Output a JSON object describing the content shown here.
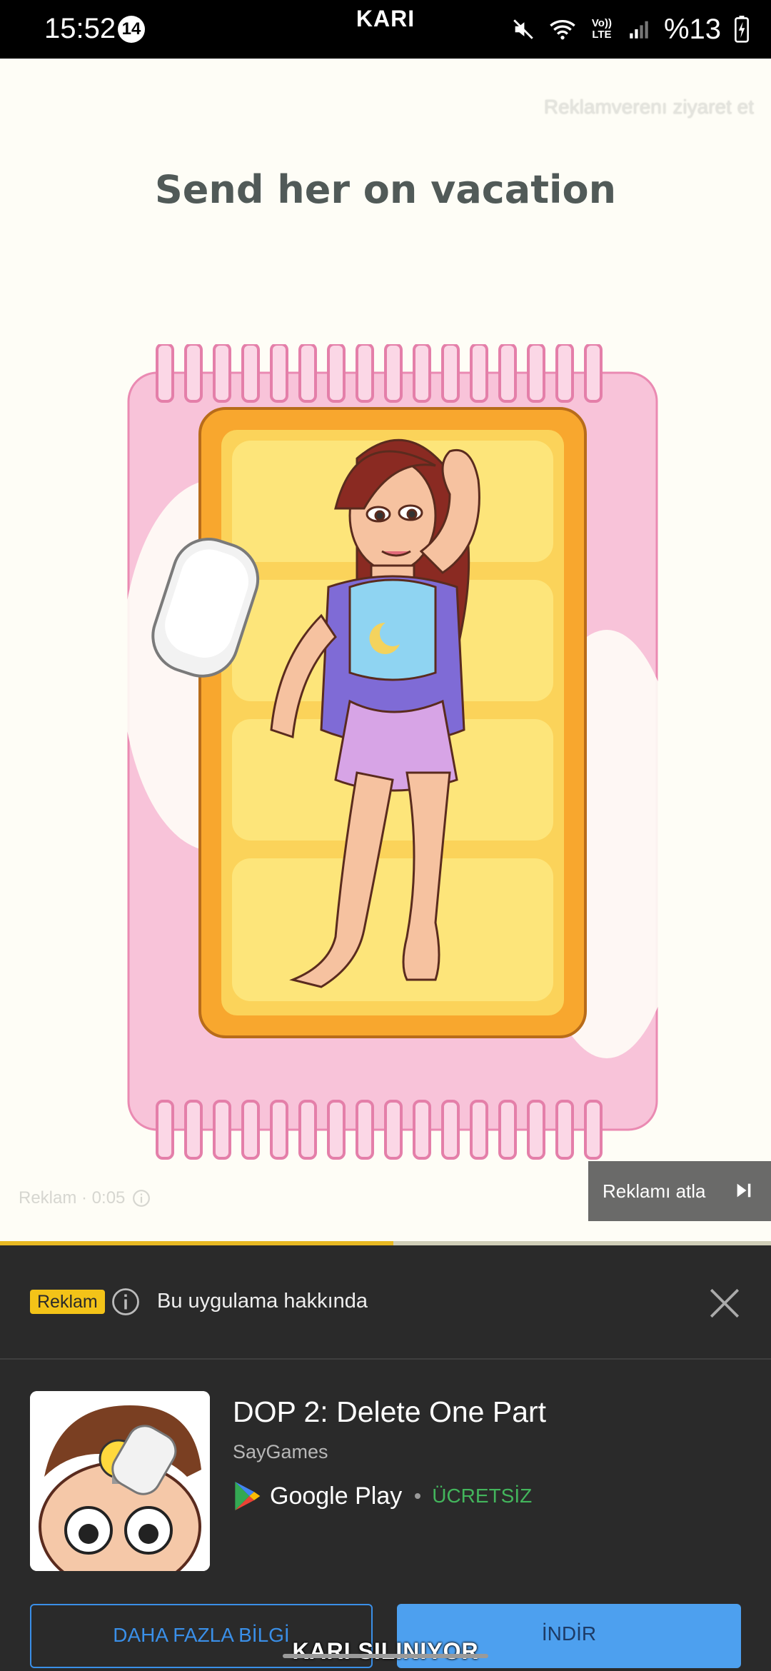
{
  "status_bar": {
    "time": "15:52",
    "notification_count": "14",
    "carrier_label": "KARI",
    "volte_label": "Vo)) LTE",
    "battery_text": "%13"
  },
  "ad": {
    "visit_advertiser": "Reklamverenı ziyaret et",
    "headline": "Send her on vacation",
    "skip_label": "Reklamı atla",
    "counter": "Reklam · 0:05",
    "progress_fraction": 0.51
  },
  "panel": {
    "ad_badge": "Reklam",
    "about_app": "Bu uygulama hakkında",
    "app_title": "DOP 2: Delete One Part",
    "developer": "SayGames",
    "store_name": "Google Play",
    "price": "ÜCRETSİZ",
    "more_info_label": "DAHA FAZLA BİLGİ",
    "install_label": "İNDİR"
  },
  "toast": "KARI SILINIYOR",
  "colors": {
    "accent_yellow": "#f3c318",
    "accent_blue": "#4da0ef",
    "price_green": "#43b55c",
    "panel_bg": "#2a2a2a"
  },
  "icons": [
    "mute-icon",
    "wifi-icon",
    "signal-icon",
    "battery-charging-icon",
    "skip-next-icon",
    "info-icon",
    "close-icon",
    "google-play-icon"
  ]
}
